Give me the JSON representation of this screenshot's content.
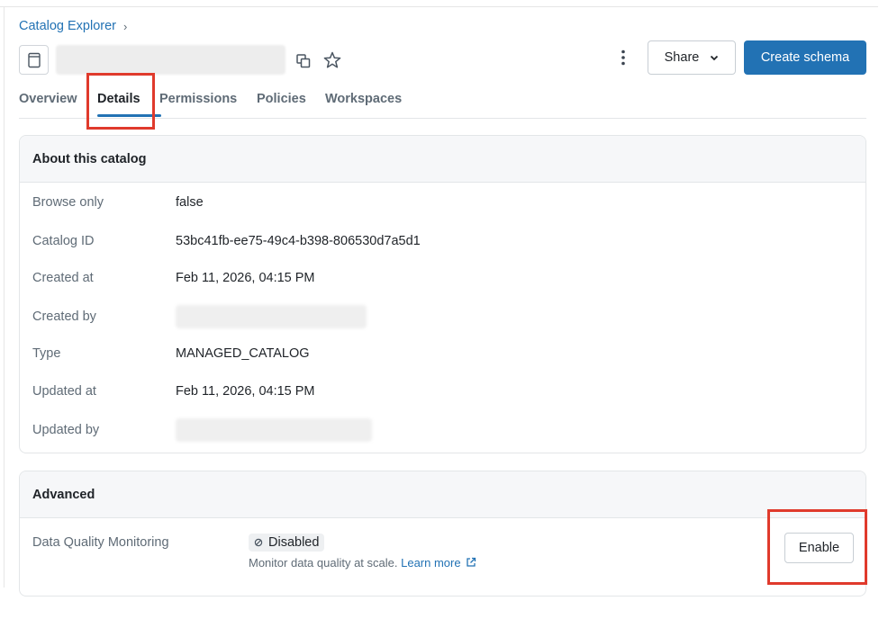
{
  "breadcrumb": {
    "label": "Catalog Explorer",
    "separator": "›"
  },
  "header": {
    "share_label": "Share",
    "create_label": "Create schema"
  },
  "tabs": [
    {
      "label": "Overview",
      "active": false
    },
    {
      "label": "Details",
      "active": true
    },
    {
      "label": "Permissions",
      "active": false
    },
    {
      "label": "Policies",
      "active": false
    },
    {
      "label": "Workspaces",
      "active": false
    }
  ],
  "about": {
    "title": "About this catalog",
    "rows": [
      {
        "label": "Browse only",
        "value": "false"
      },
      {
        "label": "Catalog ID",
        "value": "53bc41fb-ee75-49c4-b398-806530d7a5d1"
      },
      {
        "label": "Created at",
        "value": "Feb 11, 2026, 04:15 PM"
      },
      {
        "label": "Created by",
        "value": ""
      },
      {
        "label": "Type",
        "value": "MANAGED_CATALOG"
      },
      {
        "label": "Updated at",
        "value": "Feb 11, 2026, 04:15 PM"
      },
      {
        "label": "Updated by",
        "value": ""
      }
    ]
  },
  "advanced": {
    "title": "Advanced",
    "dq_label": "Data Quality Monitoring",
    "dq_status": "Disabled",
    "dq_sub": "Monitor data quality at scale.",
    "learn_more": "Learn more",
    "enable_label": "Enable"
  },
  "colors": {
    "accent": "#2272b4",
    "highlight": "#e03a2c"
  },
  "icons": [
    "catalog-icon",
    "copy-icon",
    "star-icon",
    "kebab-menu-icon",
    "chevron-down-icon",
    "disabled-icon",
    "external-link-icon"
  ]
}
